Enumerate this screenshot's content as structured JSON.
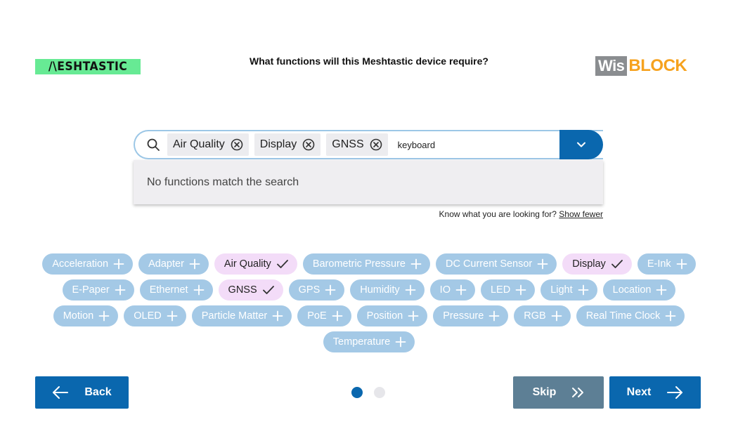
{
  "header": {
    "left_logo_text": "/\\ESHTASTIC",
    "question": "What functions will this Meshtastic device require?",
    "right_logo_wis": "Wis",
    "right_logo_block": "BLOCK",
    "colors": {
      "mesh_logo_bg": "#67ea94",
      "wis_bg": "#8a8d90",
      "block_color": "#f6a21e"
    }
  },
  "search": {
    "icon": "search-icon",
    "selected": [
      {
        "label": "Air Quality"
      },
      {
        "label": "Display"
      },
      {
        "label": "GNSS"
      }
    ],
    "query": "keyboard",
    "toggle_icon": "chevron-down-icon",
    "empty_message": "No functions match the search"
  },
  "hint": {
    "text": "Know what you are looking for?",
    "link": "Show fewer"
  },
  "functions": [
    {
      "label": "Acceleration",
      "selected": false
    },
    {
      "label": "Adapter",
      "selected": false
    },
    {
      "label": "Air Quality",
      "selected": true
    },
    {
      "label": "Barometric Pressure",
      "selected": false
    },
    {
      "label": "DC Current Sensor",
      "selected": false
    },
    {
      "label": "Display",
      "selected": true
    },
    {
      "label": "E-Ink",
      "selected": false
    },
    {
      "label": "E-Paper",
      "selected": false
    },
    {
      "label": "Ethernet",
      "selected": false
    },
    {
      "label": "GNSS",
      "selected": true
    },
    {
      "label": "GPS",
      "selected": false
    },
    {
      "label": "Humidity",
      "selected": false
    },
    {
      "label": "IO",
      "selected": false
    },
    {
      "label": "LED",
      "selected": false
    },
    {
      "label": "Light",
      "selected": false
    },
    {
      "label": "Location",
      "selected": false
    },
    {
      "label": "Motion",
      "selected": false
    },
    {
      "label": "OLED",
      "selected": false
    },
    {
      "label": "Particle Matter",
      "selected": false
    },
    {
      "label": "PoE",
      "selected": false
    },
    {
      "label": "Position",
      "selected": false
    },
    {
      "label": "Pressure",
      "selected": false
    },
    {
      "label": "RGB",
      "selected": false
    },
    {
      "label": "Real Time Clock",
      "selected": false
    },
    {
      "label": "Temperature",
      "selected": false
    }
  ],
  "footer": {
    "back_label": "Back",
    "skip_label": "Skip",
    "next_label": "Next",
    "pager": {
      "current": 1,
      "total": 2
    },
    "colors": {
      "primary": "#0a67ae",
      "skip": "#5d7f95",
      "chip_unselected": "#a4c9e6",
      "chip_selected": "#f3dcf8"
    }
  }
}
